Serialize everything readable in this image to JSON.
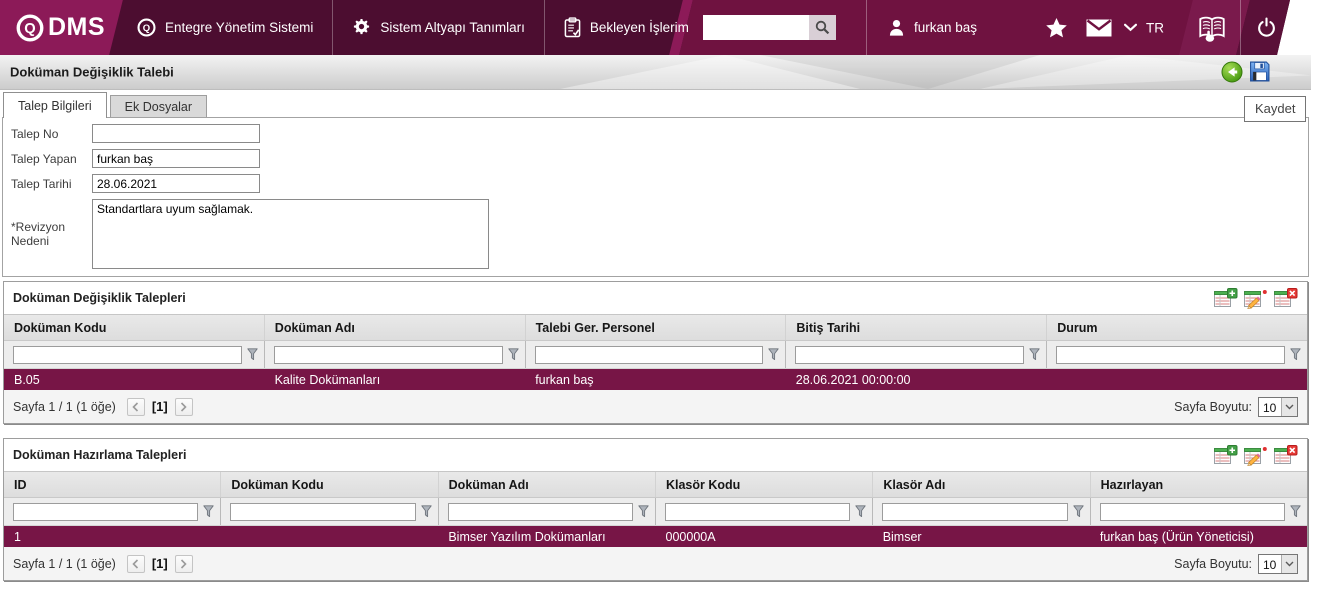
{
  "colors": {
    "brand_bright": "#8C1A58",
    "brand_dark": "#4C0D30",
    "brand_mid": "#6F1240",
    "row_highlight": "#771546"
  },
  "icons": {
    "logo_mark": "circle-q",
    "menu": [
      "circle-q",
      "gear",
      "clipboard-check"
    ],
    "search_button": "magnifier",
    "user": "person",
    "favorites": "star",
    "messages": "envelope",
    "language_chevron": "chevron-down",
    "manual": "open-book-hand",
    "logout": "power",
    "back": "green-back-arrow",
    "save": "floppy-disk",
    "grid_actions": [
      "add-record",
      "edit-record",
      "delete-record"
    ],
    "column_filter": "funnel"
  },
  "topnav": {
    "logo_q": "Q",
    "logo_text": "DMS",
    "menu": [
      {
        "label": "Entegre Yönetim Sistemi"
      },
      {
        "label": "Sistem Altyapı Tanımları"
      },
      {
        "label": "Bekleyen İşlerim"
      }
    ],
    "search": {
      "value": ""
    },
    "user_name": "furkan baş",
    "language": "TR"
  },
  "titlebar": {
    "title": "Doküman Değişiklik Talebi",
    "save_tooltip": "Kaydet"
  },
  "tabs": [
    {
      "label": "Talep Bilgileri"
    },
    {
      "label": "Ek Dosyalar"
    }
  ],
  "form": {
    "fields": [
      {
        "label": "Talep No",
        "value": ""
      },
      {
        "label": "Talep Yapan",
        "value": "furkan baş"
      },
      {
        "label": "Talep Tarihi",
        "value": "28.06.2021"
      },
      {
        "label": "*Revizyon Nedeni",
        "value": "Standartlara uyum sağlamak."
      }
    ]
  },
  "sections": [
    {
      "title": "Doküman Değişiklik Talepleri",
      "columns": [
        "Doküman Kodu",
        "Doküman Adı",
        "Talebi Ger. Personel",
        "Bitiş Tarihi",
        "Durum"
      ],
      "rows": [
        [
          "B.05",
          "Kalite Dokümanları",
          "furkan baş",
          "28.06.2021 00:00:00",
          ""
        ]
      ],
      "pager": {
        "info": "Sayfa 1 / 1 (1 öğe)",
        "page": "[1]",
        "size_label": "Sayfa Boyutu:",
        "size_value": "10"
      }
    },
    {
      "title": "Doküman Hazırlama Talepleri",
      "columns": [
        "ID",
        "Doküman Kodu",
        "Doküman Adı",
        "Klasör Kodu",
        "Klasör Adı",
        "Hazırlayan"
      ],
      "rows": [
        [
          "1",
          "",
          "Bimser Yazılım Dokümanları",
          "000000A",
          "Bimser",
          "furkan baş (Ürün Yöneticisi)"
        ]
      ],
      "pager": {
        "info": "Sayfa 1 / 1 (1 öğe)",
        "page": "[1]",
        "size_label": "Sayfa Boyutu:",
        "size_value": "10"
      }
    }
  ]
}
